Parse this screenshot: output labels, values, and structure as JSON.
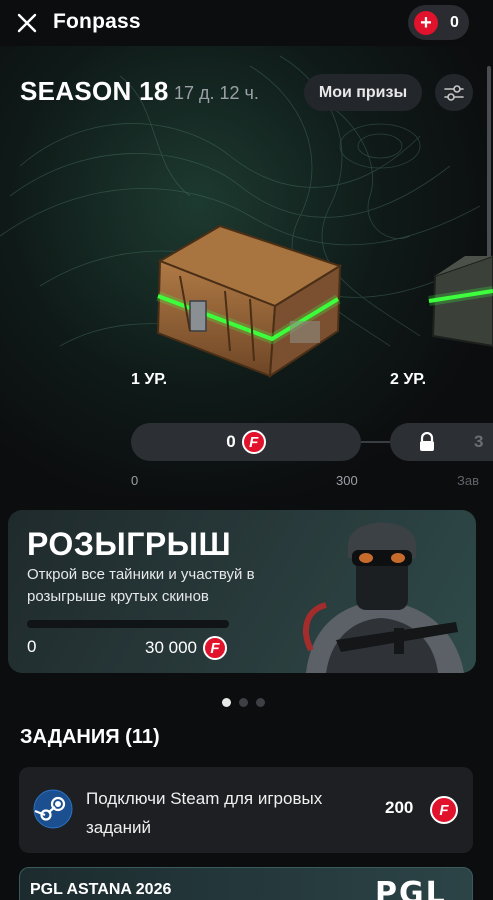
{
  "header": {
    "title": "Fonpass",
    "coin_count": "0",
    "close_icon": "close-icon",
    "plus_icon": "plus-icon"
  },
  "season": {
    "title": "SEASON 18",
    "time_left": "17 д. 12 ч.",
    "prizes_label": "Мои призы",
    "filter_icon": "sliders-icon"
  },
  "levels": [
    {
      "label": "1 УР.",
      "progress_value": "0",
      "start_tick": "0",
      "end_tick": "300",
      "locked": false
    },
    {
      "label": "2 УР.",
      "partial_value": "3",
      "partial_tick": "Зав",
      "locked": true
    }
  ],
  "giveaway": {
    "title": "РОЗЫГРЫШ",
    "subtitle": "Открой все тайники и участвуй в розыгрыше крутых скинов",
    "min": "0",
    "max": "30 000",
    "progress": 0
  },
  "carousel": {
    "count": 3,
    "active": 0
  },
  "tasks": {
    "title": "ЗАДАНИЯ (11)",
    "items": [
      {
        "text": "Подключи Steam для игровых заданий",
        "reward": "200",
        "icon": "steam-icon"
      }
    ]
  },
  "event_card": {
    "title": "PGL ASTANA 2026",
    "logo": "PGL"
  },
  "colors": {
    "accent_red": "#e0122c",
    "glow_green": "#3dff3d",
    "background": "#0c0d0f"
  }
}
